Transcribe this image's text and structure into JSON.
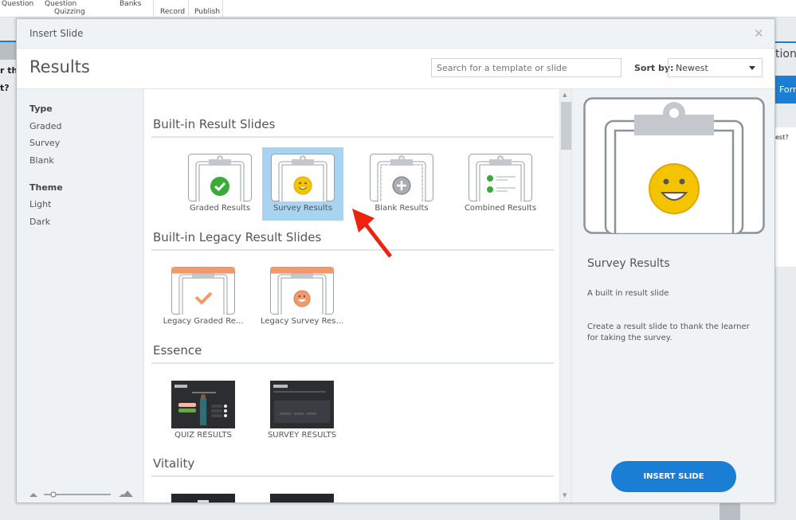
{
  "ribbon": {
    "items": [
      "Question",
      "Question",
      "Quizzing",
      "Banks",
      "Record",
      "Publish"
    ]
  },
  "background": {
    "left_text_1": "r the",
    "left_text_2": "t?",
    "right_text_1": "tion",
    "right_button": "Form",
    "right_text_2": "est?"
  },
  "dialog": {
    "title": "Insert Slide",
    "close_icon": "close-icon",
    "heading": "Results",
    "search": {
      "placeholder": "Search for a template or slide",
      "value": ""
    },
    "sort": {
      "label": "Sort by:",
      "selected": "Newest"
    },
    "filters": {
      "type_heading": "Type",
      "types": [
        "Graded",
        "Survey",
        "Blank"
      ],
      "theme_heading": "Theme",
      "themes": [
        "Light",
        "Dark"
      ]
    },
    "sections": [
      {
        "title": "Built-in Result Slides",
        "items": [
          "Graded Results",
          "Survey Results",
          "Blank Results",
          "Combined Results"
        ]
      },
      {
        "title": "Built-in Legacy Result Slides",
        "items": [
          "Legacy Graded Re...",
          "Legacy Survey Res..."
        ]
      },
      {
        "title": "Essence",
        "items": [
          "QUIZ RESULTS",
          "SURVEY RESULTS"
        ]
      },
      {
        "title": "Vitality",
        "items": [
          "",
          ""
        ]
      }
    ],
    "selected_item": "Survey Results",
    "preview": {
      "name": "Survey Results",
      "subtitle": "A built in result slide",
      "description": "Create a result slide to thank the learner for taking the survey."
    },
    "insert_label": "INSERT SLIDE"
  },
  "colors": {
    "accent": "#1a7fd4",
    "selected": "#a8d4f2",
    "legacy": "#f4996a",
    "green": "#3aaa3a",
    "yellow": "#f5c400"
  }
}
